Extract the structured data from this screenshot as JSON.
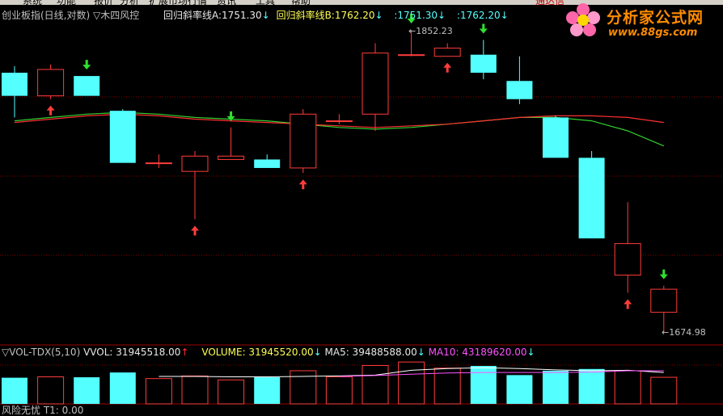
{
  "menu": [
    "系统",
    "功能",
    "报价",
    "分析",
    "扩展市场行情",
    "资讯",
    "工具",
    "帮助"
  ],
  "menu_right": "通达信",
  "main_header": {
    "index_name": "创业板指(日线,对数)",
    "formula": "▽木四风控",
    "line_a_label": "回归斜率线A:",
    "line_a_value": "1751.30",
    "line_b_label": "回归斜率线B:",
    "line_b_value": "1762.20",
    "extra_a": ":1751.30",
    "extra_b": ":1762.20",
    "arrow_down": "↓"
  },
  "annotations": {
    "high": "1852.23",
    "low": "1674.98",
    "pointer": "←"
  },
  "vol_header": {
    "indicator": "▽VOL-TDX(5,10)",
    "vvol": "VVOL: 31945518.00",
    "vvol_arrow": "↑",
    "volume": "VOLUME: 31945520.00",
    "volume_arrow": "↓",
    "ma5": "MA5: 39488588.00",
    "ma5_arrow": "↓",
    "ma10": "MA10: 43189620.00",
    "ma10_arrow": "↓"
  },
  "bottom_text": "风险无忧  T1: 0.00",
  "logo": {
    "site_name": "分析家公式网",
    "url": "www.88gs.com"
  },
  "colors": {
    "up": "#ff3c3c",
    "down": "#54ffff",
    "line_red": "#ff3030",
    "line_green": "#30d030",
    "grid": "#800000",
    "ma5": "#ffffff",
    "ma10": "#ff54ff"
  },
  "candles": [
    {
      "o": 1826,
      "h": 1830,
      "l": 1799,
      "c": 1812
    },
    {
      "o": 1812,
      "h": 1831,
      "l": 1810,
      "c": 1828
    },
    {
      "o": 1824,
      "h": 1824,
      "l": 1812,
      "c": 1812
    },
    {
      "o": 1803,
      "h": 1804,
      "l": 1772,
      "c": 1772
    },
    {
      "o": 1772,
      "h": 1777,
      "l": 1769,
      "c": 1772
    },
    {
      "o": 1767,
      "h": 1779,
      "l": 1739,
      "c": 1776
    },
    {
      "o": 1774,
      "h": 1793,
      "l": 1774,
      "c": 1776
    },
    {
      "o": 1774,
      "h": 1777,
      "l": 1769,
      "c": 1769
    },
    {
      "o": 1769,
      "h": 1804,
      "l": 1766,
      "c": 1801
    },
    {
      "o": 1797,
      "h": 1801,
      "l": 1795,
      "c": 1797
    },
    {
      "o": 1801,
      "h": 1844,
      "l": 1791,
      "c": 1838
    },
    {
      "o": 1837,
      "h": 1852.23,
      "l": 1836,
      "c": 1837
    },
    {
      "o": 1836,
      "h": 1844,
      "l": 1836,
      "c": 1841
    },
    {
      "o": 1837,
      "h": 1846,
      "l": 1822,
      "c": 1826
    },
    {
      "o": 1821,
      "h": 1836,
      "l": 1807,
      "c": 1810
    },
    {
      "o": 1799,
      "h": 1800,
      "l": 1775,
      "c": 1775
    },
    {
      "o": 1775,
      "h": 1779,
      "l": 1728,
      "c": 1728
    },
    {
      "o": 1707,
      "h": 1749,
      "l": 1697,
      "c": 1725
    },
    {
      "o": 1686,
      "h": 1701,
      "l": 1674.98,
      "c": 1699
    }
  ],
  "signals": [
    {
      "i": 1,
      "type": "buy"
    },
    {
      "i": 2,
      "type": "sell"
    },
    {
      "i": 5,
      "type": "buy"
    },
    {
      "i": 6,
      "type": "sell"
    },
    {
      "i": 8,
      "type": "buy"
    },
    {
      "i": 11,
      "type": "sell"
    },
    {
      "i": 12,
      "type": "buy"
    },
    {
      "i": 13,
      "type": "sell"
    },
    {
      "i": 17,
      "type": "buy"
    },
    {
      "i": 18,
      "type": "sell"
    }
  ],
  "line_red_values": [
    1796,
    1798,
    1800,
    1801,
    1800,
    1798,
    1797,
    1796,
    1795,
    1794,
    1793,
    1794,
    1795,
    1797,
    1799,
    1800,
    1800,
    1799,
    1796
  ],
  "line_green_values": [
    1797,
    1799,
    1801,
    1802,
    1801,
    1799,
    1798,
    1797,
    1795,
    1793,
    1792,
    1793,
    1795,
    1797,
    1799,
    1799,
    1797,
    1791,
    1782
  ],
  "volumes": [
    60,
    62,
    61,
    72,
    58,
    64,
    55,
    61,
    76,
    62,
    88,
    96,
    82,
    87,
    66,
    76,
    80,
    76,
    61
  ],
  "ma5": [
    null,
    null,
    null,
    null,
    63,
    63,
    62,
    62,
    63,
    64,
    66,
    77,
    81,
    83,
    81,
    78,
    76,
    77,
    72
  ],
  "ma10": [
    null,
    null,
    null,
    null,
    null,
    null,
    null,
    null,
    null,
    63,
    65,
    68,
    71,
    72,
    72,
    72,
    73,
    76,
    76
  ]
}
